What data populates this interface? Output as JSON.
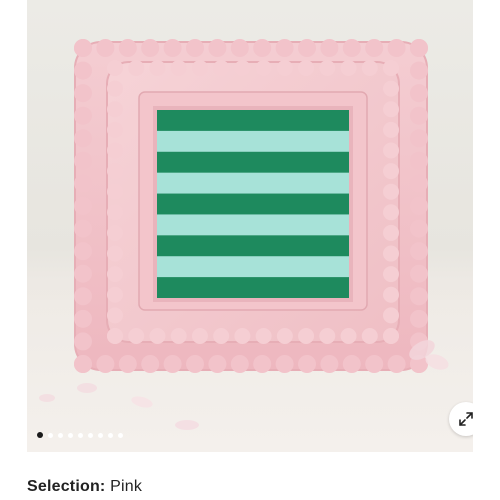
{
  "product": {
    "selection_label": "Selection:",
    "selection_value": "Pink",
    "image_subject": "scalloped-square-frames"
  },
  "gallery": {
    "slide_count": 9,
    "active_slide": 1,
    "expand_icon": "expand-arrows-icon"
  },
  "colors": {
    "frame_pink": "#f2c6cc",
    "stripe_green": "#1e8a5e",
    "stripe_light": "#a7e2d8",
    "background": "#ecebe6",
    "text": "#222222"
  }
}
